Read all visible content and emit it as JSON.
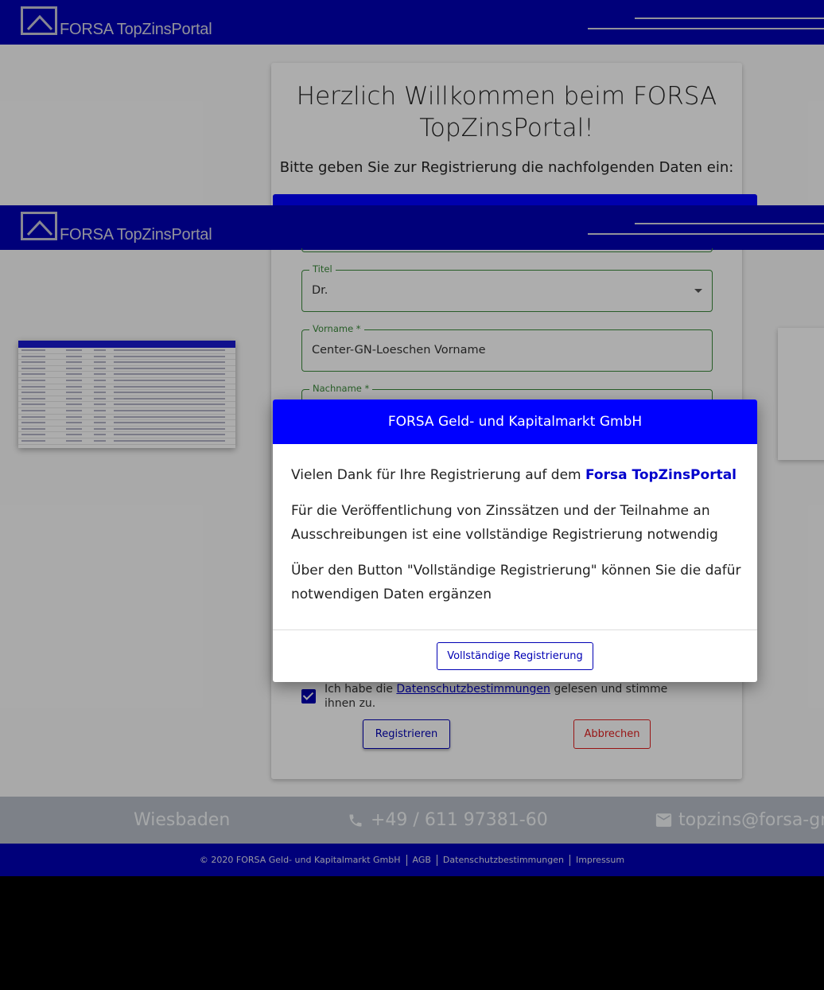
{
  "app": {
    "brand": "FORSA TopZinsPortal",
    "logo_icon": "house-roof-icon"
  },
  "card": {
    "welcome_line1": "Herzlich Willkommen beim FORSA",
    "welcome_line2": "TopZinsPortal!",
    "subtitle": "Bitte geben Sie zur Registrierung die nachfolgenden Daten ein:"
  },
  "form": {
    "titel_label": "Titel",
    "titel_value": "Dr.",
    "vorname_label": "Vorname *",
    "vorname_value": "Center-GN-Loeschen Vorname",
    "nachname_label": "Nachname *",
    "consent_prefix": "Ich habe die ",
    "consent_link": "Datenschutzbestimmungen",
    "consent_suffix": " gelesen und stimme ihnen zu.",
    "consent_checked": true,
    "register_label": "Registrieren",
    "cancel_label": "Abbrechen"
  },
  "dialog": {
    "title": "FORSA Geld- und Kapitalmarkt GmbH",
    "p1_prefix": "Vielen Dank für Ihre Registrierung auf dem ",
    "p1_portal": "Forsa TopZinsPortal",
    "p2": "Für die Veröffentlichung von Zinssätzen und der Teilnahme an Ausschreibungen ist eine vollständige Registrierung notwendig",
    "p3": "Über den Button \"Vollständige Registrierung\" können Sie die dafür notwendigen Daten ergänzen",
    "button_label": "Vollständige Registrierung"
  },
  "contact": {
    "city": "Wiesbaden",
    "phone": "+49 / 611 97381-60",
    "email": "topzins@forsa-gmbh.de",
    "phone_icon": "phone-icon",
    "mail_icon": "mail-icon"
  },
  "legal": {
    "copyright": "© 2020 FORSA Geld- und Kapitalmarkt GmbH",
    "agb": "AGB",
    "datenschutz": "Datenschutzbestimmungen",
    "impressum": "Impressum"
  },
  "colors": {
    "brand_blue": "#0000b4",
    "dialog_blue": "#0000ff",
    "field_green": "#3a8a3a",
    "cancel_red": "#e02020"
  }
}
